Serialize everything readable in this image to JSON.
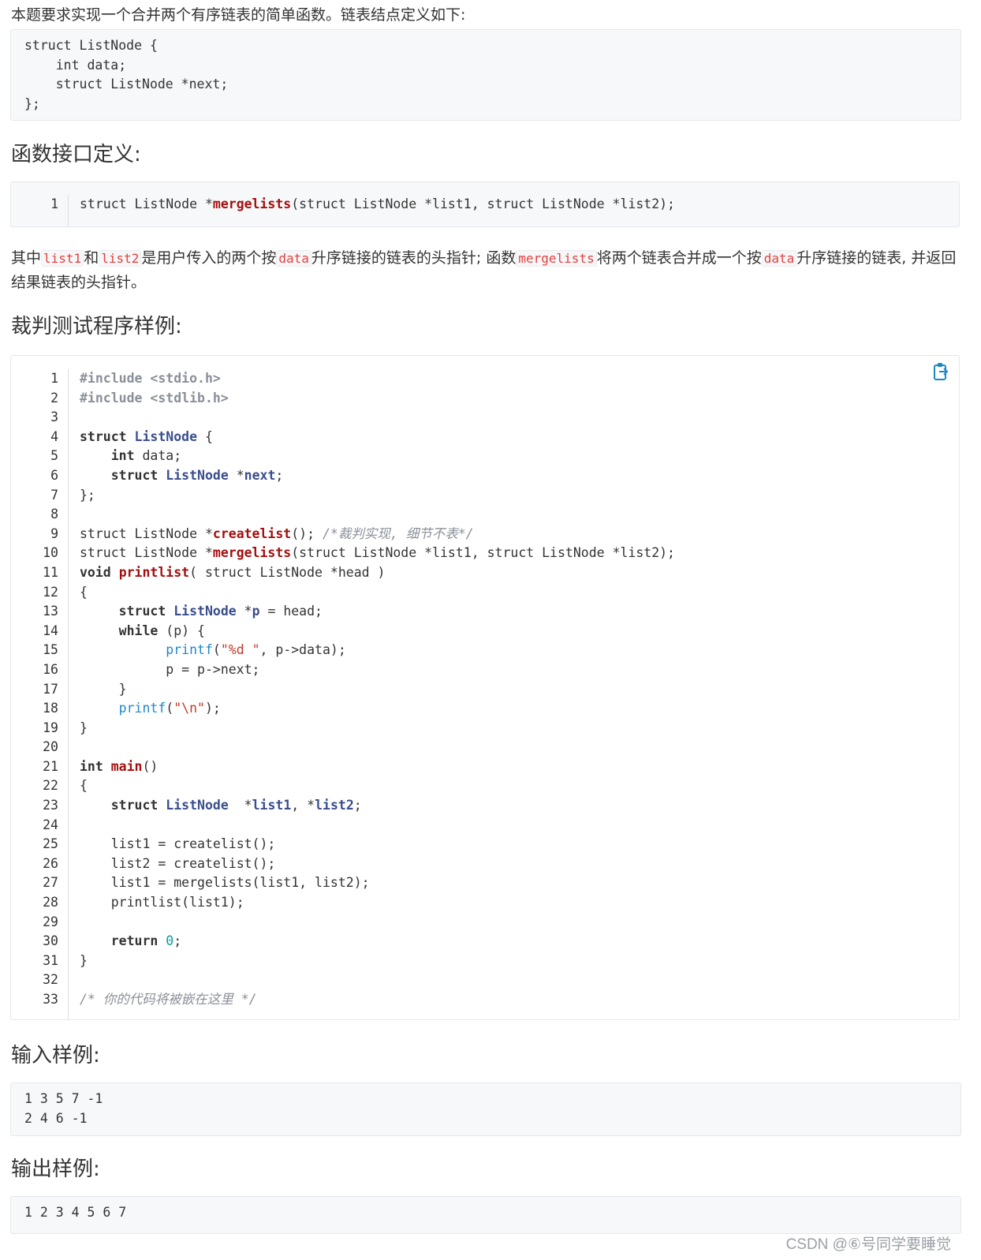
{
  "intro": "本题要求实现一个合并两个有序链表的简单函数。链表结点定义如下:",
  "struct_code": "struct ListNode {\n    int data;\n    struct ListNode *next;\n};",
  "headings": {
    "interface": "函数接口定义:",
    "judge": "裁判测试程序样例:",
    "input": "输入样例:",
    "output": "输出样例:"
  },
  "interface_code": {
    "line_no": "1",
    "pre": "struct ListNode *",
    "fn": "mergelists",
    "post": "(struct ListNode *list1, struct ListNode *list2);"
  },
  "description": {
    "t1": "其中",
    "c1": "list1",
    "t2": "和",
    "c2": "list2",
    "t3": "是用户传入的两个按",
    "c3": "data",
    "t4": "升序链接的链表的头指针; 函数",
    "c4": "mergelists",
    "t5": "将两个链表合并成一个按",
    "c5": "data",
    "t6": "升序链接的链表, 并返回结果链表的头指针。"
  },
  "judge_code": {
    "line_numbers": [
      "1",
      "2",
      "3",
      "4",
      "5",
      "6",
      "7",
      "8",
      "9",
      "10",
      "11",
      "12",
      "13",
      "14",
      "15",
      "16",
      "17",
      "18",
      "19",
      "20",
      "21",
      "22",
      "23",
      "24",
      "25",
      "26",
      "27",
      "28",
      "29",
      "30",
      "31",
      "32",
      "33"
    ],
    "tokens": {
      "l1": "#include <stdio.h>",
      "l2": "#include <stdlib.h>",
      "struct": "struct",
      "ListNode": "ListNode",
      "int": "int",
      "data_decl": " data;",
      "next_star": " *",
      "next": "next",
      "semi": ";",
      "open_brace_sp": " {",
      "close_struct": "};",
      "sl_pre": "struct ListNode *",
      "createlist": "createlist",
      "l9_mid": "(); ",
      "l9_comment": "/*裁判实现, 细节不表*/",
      "mergelists": "mergelists",
      "l10_post": "(struct ListNode *list1, struct ListNode *list2);",
      "void": "void",
      "printlist": "printlist",
      "l11_post": "( struct ListNode *head )",
      "open_brace": "{",
      "close_brace": "}",
      "p_var": "p",
      "l13_post": " = head;",
      "while": "while",
      "l14_post": " (p) {",
      "printf": "printf",
      "paren_open": "(",
      "fmt": "\"%d \"",
      "l15_post": ", p->data);",
      "l16": "p = p->next;",
      "newline_str": "\"\\n\"",
      "paren_close_semi": ");",
      "main": "main",
      "empty_parens": "()",
      "l23_star1": "  *",
      "list1": "list1",
      "comma_star": ", *",
      "list2": "list2",
      "l25": "list1 = createlist();",
      "l26": "list2 = createlist();",
      "l27": "list1 = mergelists(list1, list2);",
      "l28": "printlist(list1);",
      "return": "return",
      "zero": "0",
      "l33": "/* 你的代码将被嵌在这里 */"
    }
  },
  "input_sample": "1 3 5 7 -1\n2 4 6 -1",
  "output_sample": "1 2 3 4 5 6 7",
  "watermark": "CSDN @⑥号同学要睡觉",
  "icons": {
    "copy": "clipboard-copy-icon"
  },
  "colors": {
    "inline_code": "#e2413d",
    "type": "#3a4e8c",
    "function": "#a50e0e",
    "builtin": "#1e88c7"
  }
}
